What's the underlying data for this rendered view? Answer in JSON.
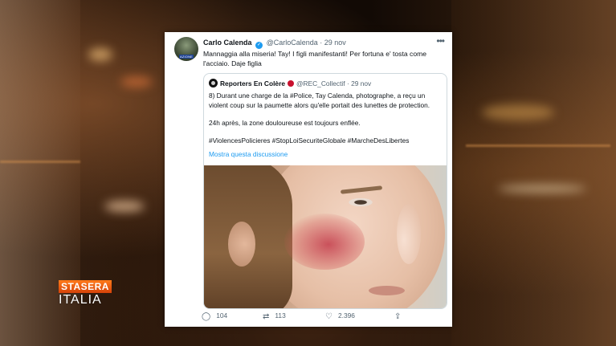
{
  "tweet": {
    "author_name": "Carlo Calenda",
    "author_handle": "@CarloCalenda",
    "date": "29 nov",
    "avatar_label": "AZIONE",
    "text": "Mannaggia alla miseria! Tay! I figli manifestanti! Per fortuna e' tosta come l'acciaio. Daje figlia",
    "more": "•••",
    "quoted": {
      "author_name": "Reporters En Colère",
      "author_handle": "@REC_Collectif",
      "date": "29 nov",
      "paragraph_1": "8) Durant une charge de la #Police, Tay Calenda, photographe, a reçu un violent coup sur la paumette alors qu'elle portait des lunettes de protection.",
      "paragraph_2": "24h après, la zone douloureuse est toujours enflée.",
      "paragraph_3": "#ViolencesPolicieres #StopLoiSecuriteGlobale #MarcheDesLibertes",
      "show_thread": "Mostra questa discussione"
    },
    "actions": {
      "replies": "104",
      "retweets": "113",
      "likes": "2.396"
    }
  },
  "broadcast": {
    "logo_top": "STASERA",
    "logo_bottom": "ITALIA"
  },
  "colors": {
    "accent": "#1d9bf0",
    "logo_orange": "#ff7a1a"
  }
}
